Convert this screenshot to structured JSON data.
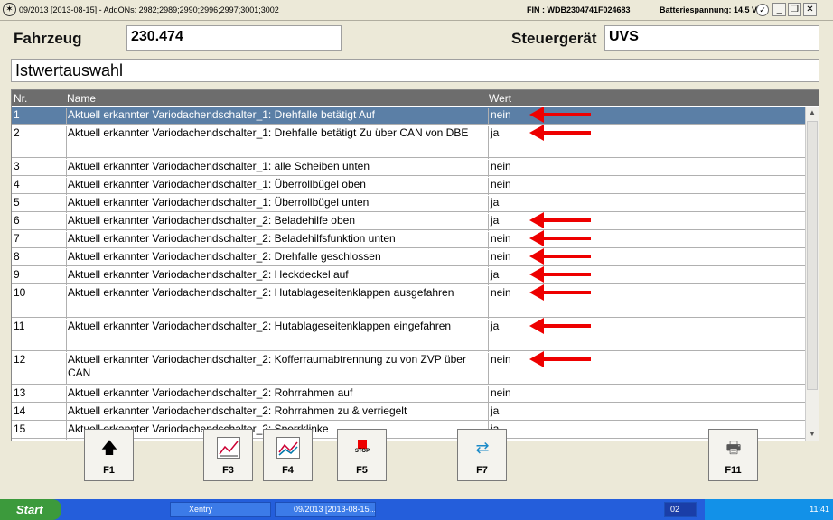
{
  "titlebar": {
    "title": "09/2013 [2013-08-15] - AddONs: 2982;2989;2990;2996;2997;3001;3002",
    "fin": "FIN : WDB2304741F024683",
    "battery": "Batteriespannung: 14.5 V",
    "ok_icon": "check-icon"
  },
  "header": {
    "vehicle_label": "Fahrzeug",
    "vehicle_value": "230.474",
    "ecu_label": "Steuergerät",
    "ecu_value": "UVS"
  },
  "section_title": "Istwertauswahl",
  "table": {
    "columns": [
      "Nr.",
      "Name",
      "Wert"
    ],
    "rows": [
      {
        "nr": "1",
        "name": "Aktuell erkannter Variodachendschalter_1: Drehfalle betätigt Auf",
        "value": "nein",
        "selected": true,
        "marked": true
      },
      {
        "nr": "2",
        "name": "Aktuell erkannter Variodachendschalter_1: Drehfalle betätigt Zu über CAN von DBE",
        "value": "ja",
        "marked": true
      },
      {
        "nr": "3",
        "name": "Aktuell erkannter Variodachendschalter_1: alle Scheiben unten",
        "value": "nein"
      },
      {
        "nr": "4",
        "name": "Aktuell erkannter Variodachendschalter_1: Überrollbügel oben",
        "value": "nein"
      },
      {
        "nr": "5",
        "name": "Aktuell erkannter Variodachendschalter_1: Überrollbügel unten",
        "value": "ja"
      },
      {
        "nr": "6",
        "name": "Aktuell erkannter Variodachendschalter_2: Beladehilfe oben",
        "value": "ja",
        "marked": true
      },
      {
        "nr": "7",
        "name": "Aktuell erkannter Variodachendschalter_2: Beladehilfsfunktion unten",
        "value": "nein",
        "marked": true
      },
      {
        "nr": "8",
        "name": "Aktuell erkannter Variodachendschalter_2: Drehfalle geschlossen",
        "value": "nein",
        "marked": true
      },
      {
        "nr": "9",
        "name": "Aktuell erkannter Variodachendschalter_2: Heckdeckel auf",
        "value": "ja",
        "marked": true
      },
      {
        "nr": "10",
        "name": "Aktuell erkannter Variodachendschalter_2: Hutablageseitenklappen ausgefahren",
        "value": "nein",
        "marked": true
      },
      {
        "nr": "11",
        "name": "Aktuell erkannter Variodachendschalter_2: Hutablageseitenklappen eingefahren",
        "value": "ja",
        "marked": true
      },
      {
        "nr": "12",
        "name": "Aktuell erkannter Variodachendschalter_2: Kofferraumabtrennung zu von ZVP über CAN",
        "value": "nein",
        "marked": true
      },
      {
        "nr": "13",
        "name": "Aktuell erkannter Variodachendschalter_2: Rohrrahmen auf",
        "value": "nein"
      },
      {
        "nr": "14",
        "name": "Aktuell erkannter Variodachendschalter_2: Rohrrahmen zu & verriegelt",
        "value": "ja"
      },
      {
        "nr": "15",
        "name": "Aktuell erkannter Variodachendschalter_2: Sperrklinke",
        "value": "ja"
      }
    ]
  },
  "fkeys": [
    {
      "key": "F1",
      "icon": "arrow-up-icon"
    },
    {
      "key": "F3",
      "icon": "chart-icon"
    },
    {
      "key": "F4",
      "icon": "multi-chart-icon"
    },
    {
      "key": "F5",
      "icon": "stop-icon",
      "icon_text": "STOP"
    },
    {
      "key": "F7",
      "icon": "swap-arrows-icon"
    },
    {
      "key": "F11",
      "icon": "printer-icon"
    }
  ],
  "taskbar": {
    "start": "Start",
    "tasks": [
      "Xentry",
      "09/2013 [2013-08-15..."
    ],
    "tray_badge": "02",
    "clock": "11:41"
  },
  "colors": {
    "selection": "#5b7fa6",
    "header_bg": "#6d6d6d",
    "arrow": "#ee0000",
    "taskbar": "#245edb"
  }
}
